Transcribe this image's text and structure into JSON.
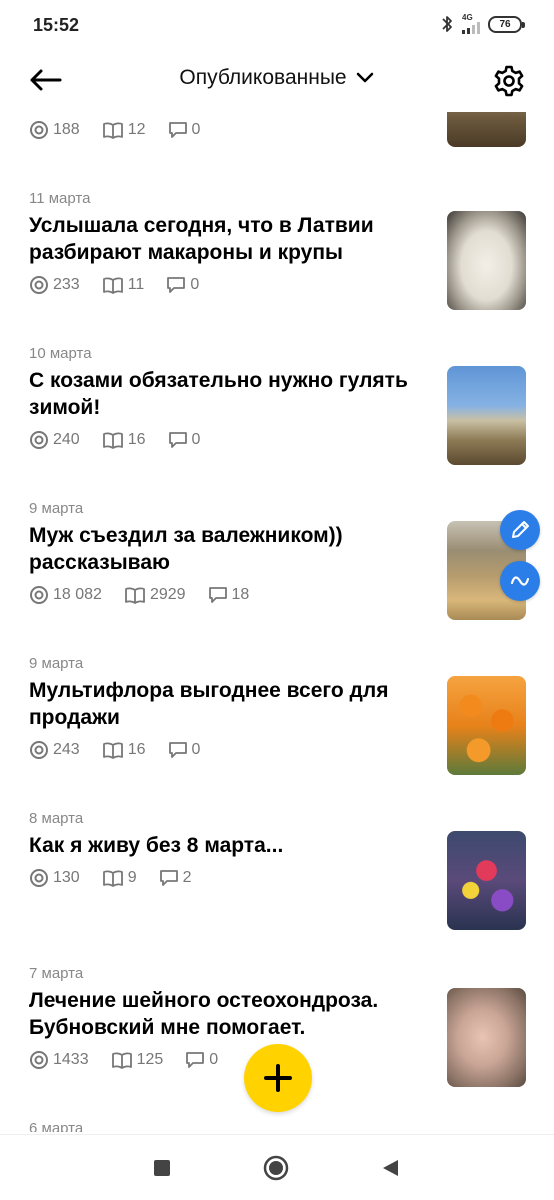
{
  "status_bar": {
    "time": "15:52",
    "network": "4G",
    "battery": "76"
  },
  "header": {
    "title": "Опубликованные",
    "back_icon": "arrow-left-icon",
    "dropdown_icon": "chevron-down-icon",
    "settings_icon": "gear-icon"
  },
  "posts": [
    {
      "date": "",
      "title": "",
      "views": "188",
      "reads": "12",
      "comments": "0"
    },
    {
      "date": "11 марта",
      "title": "Услышала сегодня, что в Латвии разбирают макароны и крупы",
      "views": "233",
      "reads": "11",
      "comments": "0"
    },
    {
      "date": "10 марта",
      "title": "С козами обязательно нужно гулять зимой!",
      "views": "240",
      "reads": "16",
      "comments": "0"
    },
    {
      "date": "9 марта",
      "title": "Муж съездил за валежником)) рассказываю",
      "views": "18 082",
      "reads": "2929",
      "comments": "18"
    },
    {
      "date": "9 марта",
      "title": "Мультифлора выгоднее всего для продажи",
      "views": "243",
      "reads": "16",
      "comments": "0"
    },
    {
      "date": "8 марта",
      "title": "Как я живу без 8 марта...",
      "views": "130",
      "reads": "9",
      "comments": "2"
    },
    {
      "date": "7 марта",
      "title": "Лечение шейного остеохондроза. Бубновский мне помогает.",
      "views": "1433",
      "reads": "125",
      "comments": "0"
    },
    {
      "date": "6 марта",
      "title": "",
      "views": "",
      "reads": "",
      "comments": ""
    }
  ],
  "floating": {
    "edit_icon": "pencil-icon",
    "wave_icon": "wave-icon",
    "add_icon": "plus-icon",
    "add_color": "#ffd200",
    "accent_color": "#2b7de8"
  },
  "navbar": {
    "recent_icon": "square-icon",
    "home_icon": "circle-icon",
    "back_icon": "triangle-back-icon"
  }
}
